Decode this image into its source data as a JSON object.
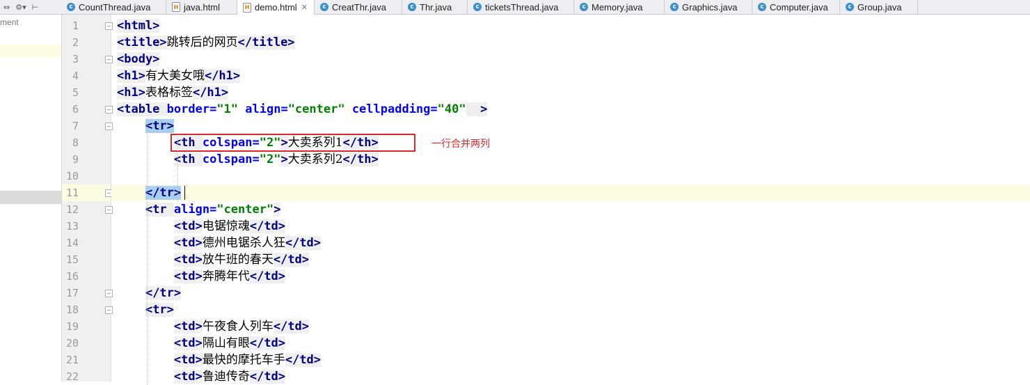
{
  "toolbar": {
    "collapse_icon": "⇔",
    "settings_icon": "⚙▾",
    "hide_icon": "⊢"
  },
  "tabs": [
    {
      "label": "CountThread.java",
      "type": "java",
      "active": false
    },
    {
      "label": "java.html",
      "type": "html",
      "active": false
    },
    {
      "label": "demo.html",
      "type": "html",
      "active": true
    },
    {
      "label": "CreatThr.java",
      "type": "java",
      "active": false
    },
    {
      "label": "Thr.java",
      "type": "java",
      "active": false
    },
    {
      "label": "ticketsThread.java",
      "type": "java",
      "active": false
    },
    {
      "label": "Memory.java",
      "type": "java",
      "active": false
    },
    {
      "label": "Graphics.java",
      "type": "java",
      "active": false
    },
    {
      "label": "Computer.java",
      "type": "java",
      "active": false
    },
    {
      "label": "Group.java",
      "type": "java",
      "active": false
    }
  ],
  "project_pane": {
    "fragment_text": "ment"
  },
  "editor": {
    "current_line": 11,
    "lines": [
      [
        [
          "tg",
          "<html>"
        ]
      ],
      [
        [
          "tg",
          "<title>"
        ],
        [
          "txt",
          "跳转后的网页"
        ],
        [
          "tg",
          "</title>"
        ]
      ],
      [
        [
          "tg",
          "<body>"
        ]
      ],
      [
        [
          "tg",
          "<h1>"
        ],
        [
          "txt",
          "有大美女哦"
        ],
        [
          "tg",
          "</h1>"
        ]
      ],
      [
        [
          "tg",
          "<h1>"
        ],
        [
          "txt",
          "表格标签"
        ],
        [
          "tg",
          "</h1>"
        ]
      ],
      [
        [
          "tg",
          "<table "
        ],
        [
          "an",
          "border="
        ],
        [
          "av",
          "\"1\""
        ],
        [
          "an",
          " align="
        ],
        [
          "av",
          "\"center\""
        ],
        [
          "an",
          " cellpadding="
        ],
        [
          "av",
          "\"40\""
        ],
        [
          "tg",
          "  >"
        ]
      ],
      [
        [
          "sp",
          "    "
        ],
        [
          "tgsel",
          "<tr>"
        ]
      ],
      [
        [
          "sp",
          "        "
        ],
        [
          "tg",
          "<th "
        ],
        [
          "an",
          "colspan="
        ],
        [
          "av",
          "\"2\""
        ],
        [
          "tg",
          ">"
        ],
        [
          "txt",
          "大卖系列1"
        ],
        [
          "tg",
          "</th>"
        ]
      ],
      [
        [
          "sp",
          "        "
        ],
        [
          "tg",
          "<th "
        ],
        [
          "an",
          "colspan="
        ],
        [
          "av",
          "\"2\""
        ],
        [
          "tg",
          ">"
        ],
        [
          "txt",
          "大卖系列2"
        ],
        [
          "tg",
          "</th>"
        ]
      ],
      [],
      [
        [
          "sp",
          "    "
        ],
        [
          "tgsel",
          "</tr>"
        ]
      ],
      [
        [
          "sp",
          "    "
        ],
        [
          "tg",
          "<tr "
        ],
        [
          "an",
          "align="
        ],
        [
          "av",
          "\"center\""
        ],
        [
          "tg",
          ">"
        ]
      ],
      [
        [
          "sp",
          "        "
        ],
        [
          "tg",
          "<td>"
        ],
        [
          "txt",
          "电锯惊魂"
        ],
        [
          "tg",
          "</td>"
        ]
      ],
      [
        [
          "sp",
          "        "
        ],
        [
          "tg",
          "<td>"
        ],
        [
          "txt",
          "德州电锯杀人狂"
        ],
        [
          "tg",
          "</td>"
        ]
      ],
      [
        [
          "sp",
          "        "
        ],
        [
          "tg",
          "<td>"
        ],
        [
          "txt",
          "放牛班的春天"
        ],
        [
          "tg",
          "</td>"
        ]
      ],
      [
        [
          "sp",
          "        "
        ],
        [
          "tg",
          "<td>"
        ],
        [
          "txt",
          "奔腾年代"
        ],
        [
          "tg",
          "</td>"
        ]
      ],
      [
        [
          "sp",
          "    "
        ],
        [
          "tg",
          "</tr>"
        ]
      ],
      [
        [
          "sp",
          "    "
        ],
        [
          "tg",
          "<tr>"
        ]
      ],
      [
        [
          "sp",
          "        "
        ],
        [
          "tg",
          "<td>"
        ],
        [
          "txt",
          "午夜食人列车"
        ],
        [
          "tg",
          "</td>"
        ]
      ],
      [
        [
          "sp",
          "        "
        ],
        [
          "tg",
          "<td>"
        ],
        [
          "txt",
          "隔山有眼"
        ],
        [
          "tg",
          "</td>"
        ]
      ],
      [
        [
          "sp",
          "        "
        ],
        [
          "tg",
          "<td>"
        ],
        [
          "txt",
          "最快的摩托车手"
        ],
        [
          "tg",
          "</td>"
        ]
      ],
      [
        [
          "sp",
          "        "
        ],
        [
          "tg",
          "<td>"
        ],
        [
          "txt",
          "鲁迪传奇"
        ],
        [
          "tg",
          "</td>"
        ]
      ]
    ],
    "fold_markers": {
      "1": "−",
      "3": "−",
      "6": "−",
      "7": "−",
      "11": "−",
      "12": "−",
      "17": "−",
      "18": "−"
    }
  },
  "annotation": {
    "text": "一行合并两列",
    "color": "#e0262a",
    "line": 8
  },
  "colors": {
    "tag": "#000080",
    "attr_name": "#0000ff",
    "attr_value": "#008000",
    "current_line_bg": "#fdfbe2",
    "selection_bg": "#a8cef0"
  }
}
